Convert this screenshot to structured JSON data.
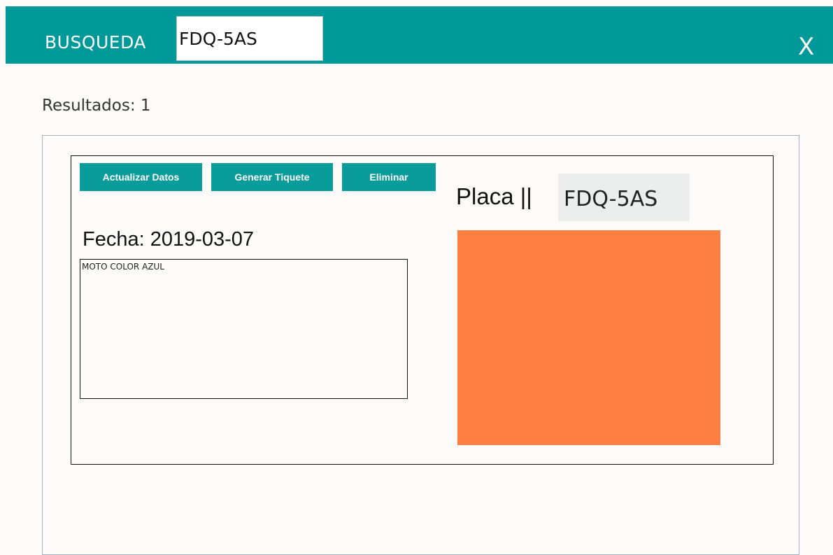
{
  "header": {
    "title": "BUSQUEDA",
    "search_value": "FDQ-5AS",
    "close_label": "X",
    "background_color": "#009999"
  },
  "results": {
    "label": "Resultados: 1"
  },
  "record": {
    "buttons": {
      "update_label": "Actualizar Datos",
      "ticket_label": "Generar Tiquete",
      "delete_label": "Eliminar"
    },
    "date_text": "Fecha: 2019-03-07",
    "notes": "MOTO COLOR AZUL",
    "plate_label": "Placa ||",
    "plate_value": "FDQ-5AS",
    "swatch_color": "#ff7f42"
  }
}
